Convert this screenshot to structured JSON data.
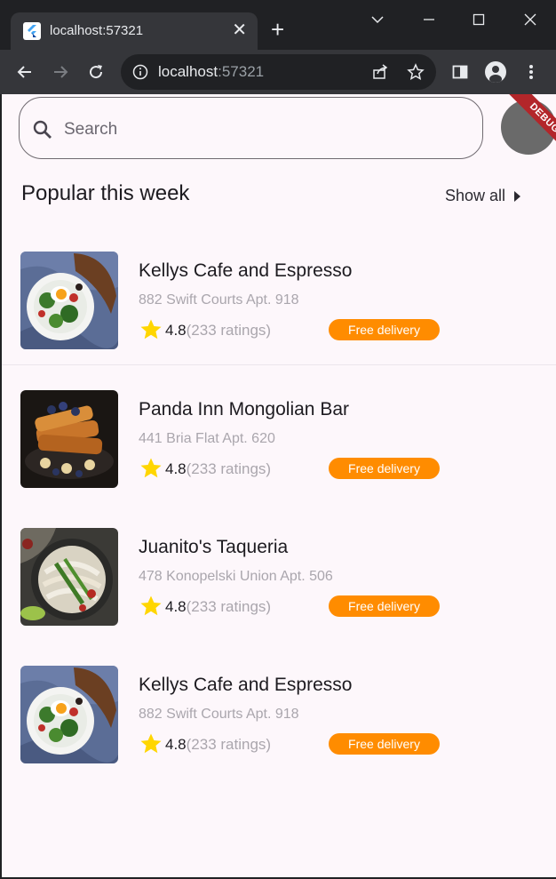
{
  "browser": {
    "tab_title": "localhost:57321",
    "tab_close": "✕",
    "new_tab": "+",
    "url_host": "localhost",
    "url_port": ":57321"
  },
  "app": {
    "search_placeholder": "Search",
    "debug_banner": "DEBUG",
    "section_title": "Popular this week",
    "show_all_label": "Show all",
    "restaurants": [
      {
        "name": "Kellys Cafe and Espresso",
        "address": "882 Swift Courts Apt. 918",
        "rating": "4.8",
        "ratings_count": "(233 ratings)",
        "badge": "Free delivery",
        "image": "salad-bowl"
      },
      {
        "name": "Panda Inn Mongolian Bar",
        "address": "441 Bria Flat Apt. 620",
        "rating": "4.8",
        "ratings_count": "(233 ratings)",
        "badge": "Free delivery",
        "image": "french-toast"
      },
      {
        "name": "Juanito's Taqueria",
        "address": "478 Konopelski Union Apt. 506",
        "rating": "4.8",
        "ratings_count": "(233 ratings)",
        "badge": "Free delivery",
        "image": "noodle-bowl"
      },
      {
        "name": "Kellys Cafe and Espresso",
        "address": "882 Swift Courts Apt. 918",
        "rating": "4.8",
        "ratings_count": "(233 ratings)",
        "badge": "Free delivery",
        "image": "salad-bowl"
      }
    ]
  },
  "colors": {
    "accent_badge": "#ff8c00",
    "star": "#ffd600",
    "app_background": "#fdf7fb",
    "debug_banner": "#b3262a"
  }
}
